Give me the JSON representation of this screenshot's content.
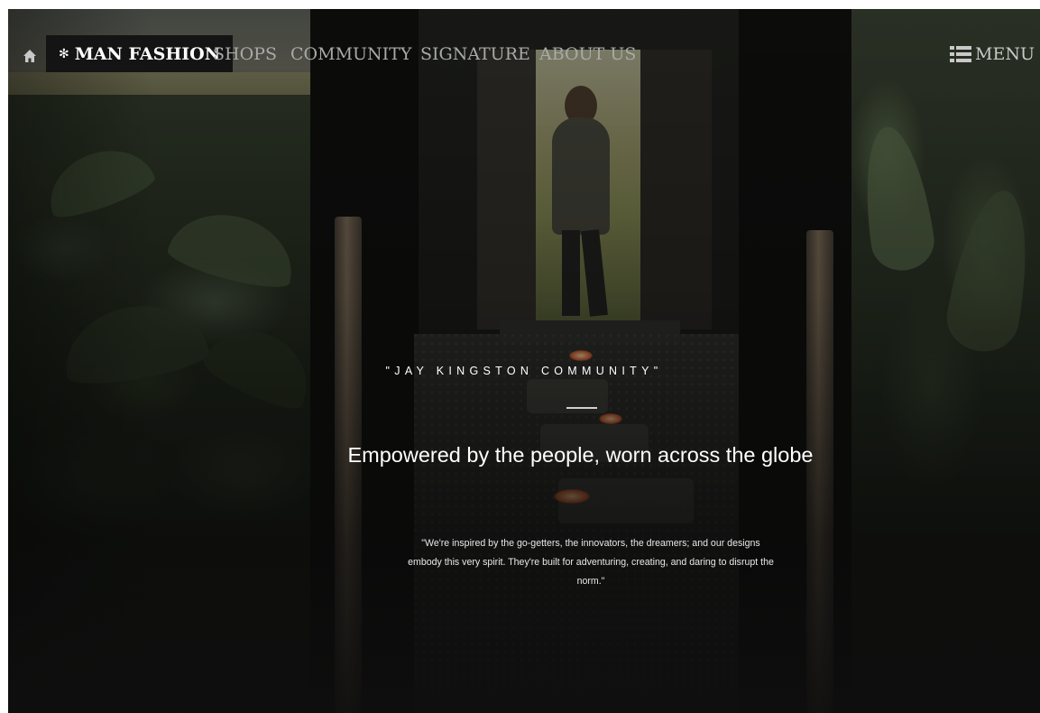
{
  "nav": {
    "home_icon": "home-icon",
    "brand_icon": "asterisk-icon",
    "brand_label": "MAN FASHION",
    "links": [
      "SHOPS",
      "COMMUNITY",
      "SIGNATURE",
      "ABOUT US"
    ],
    "menu_icon": "list-icon",
    "menu_label": "MENU"
  },
  "hero": {
    "eyebrow": "\"JAY KINGSTON COMMUNITY\"",
    "headline": "Empowered by the people, worn across the globe",
    "quote": "\"We're inspired by the go-getters, the innovators, the dreamers; and our designs embody this very spirit. They're built for adventuring, creating, and daring to disrupt the norm.\""
  },
  "colors": {
    "brand_bg": "#141414",
    "nav_link": "#a9a9a9",
    "text": "#ffffff"
  }
}
